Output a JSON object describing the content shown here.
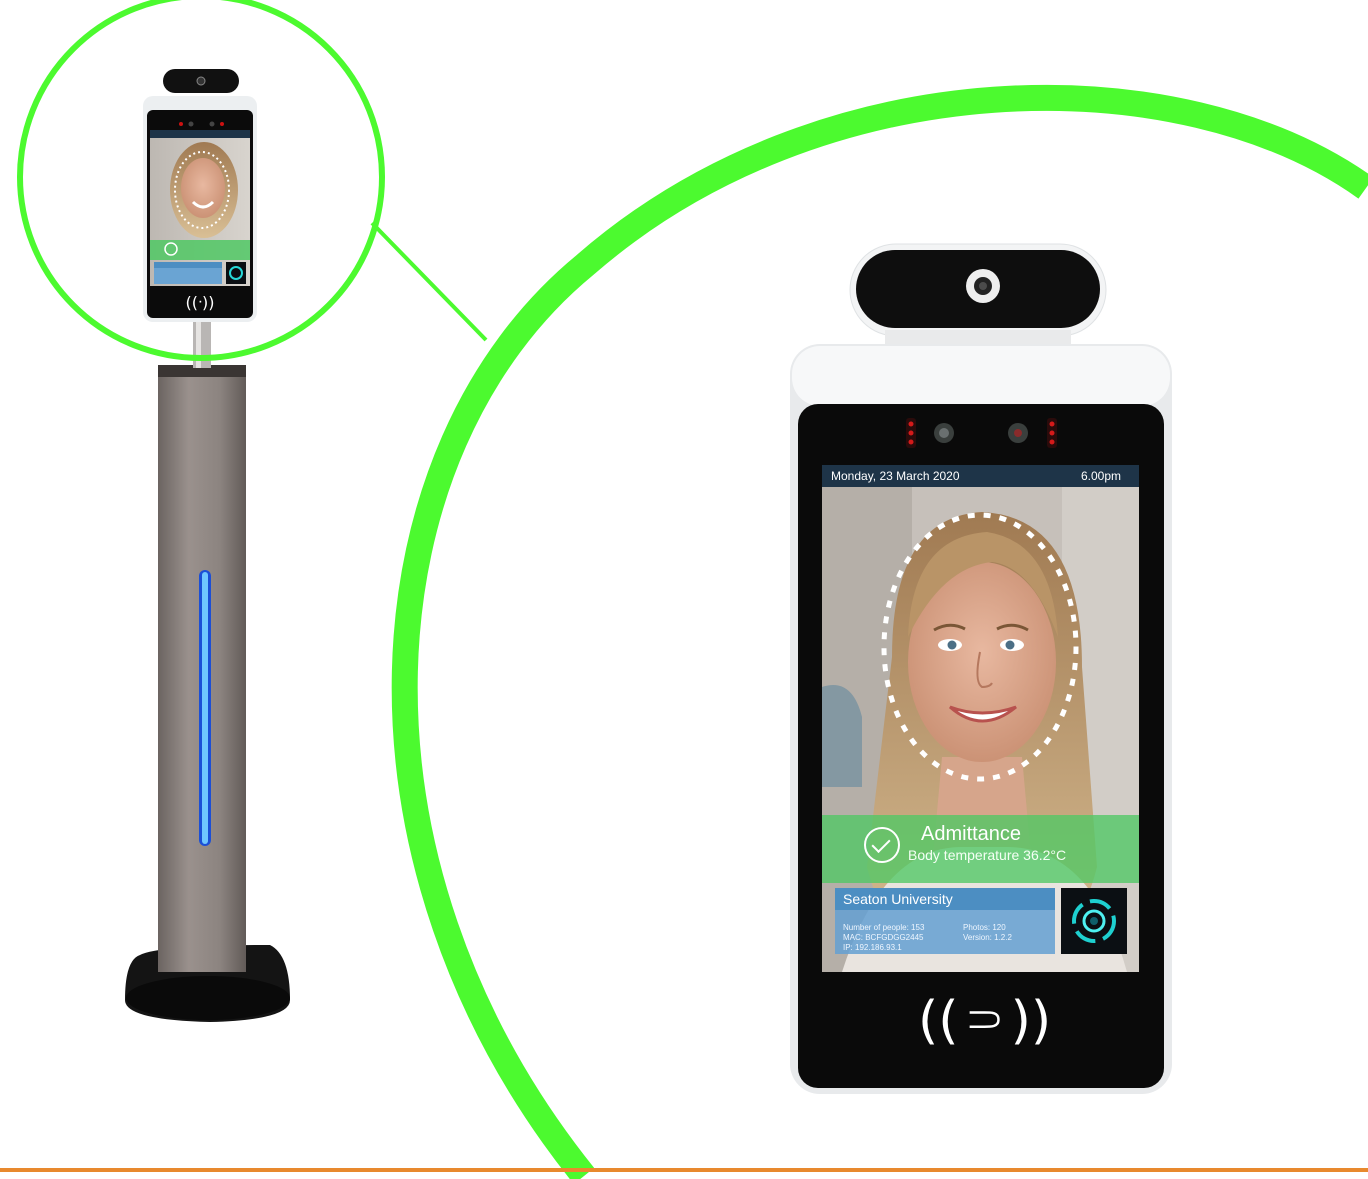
{
  "kiosk": {
    "date": "Monday, 23 March 2020",
    "time": "6.00pm",
    "status_title": "Admittance",
    "status_detail": "Body temperature 36.2°C",
    "organization": "Seaton University",
    "people": "Number of people: 153",
    "mac": "MAC: BCFGDGG2445",
    "ip": "IP: 192.186.93.1",
    "photos": "Photos: 120",
    "version": "Version: 1.2.2",
    "nfc_symbol": "((⸧))"
  },
  "colors": {
    "zoom_ring": "#4cfa2f",
    "stripe": "#e8892e",
    "led": "#3a8bff",
    "admit_green": "#50c864"
  }
}
